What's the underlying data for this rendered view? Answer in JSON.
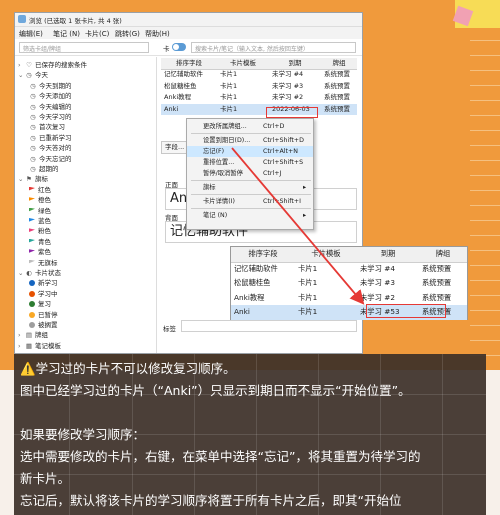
{
  "window": {
    "title": "浏览 (已选取 1 张卡片, 共 4 张)",
    "menus": [
      "编辑(E)",
      "笔记 (N)",
      "卡片(C)",
      "跳转(G)",
      "帮助(H)"
    ],
    "toggle_label": "卡",
    "sidebar_search_placeholder": "筛选卡组/牌组",
    "search_placeholder": "搜索卡片/笔记（输入文本, 然后按回车键）"
  },
  "sidebar": [
    {
      "label": "已保存的搜索条件",
      "icon": "heart-icon",
      "level": 0
    },
    {
      "label": "今天",
      "icon": "clock-icon",
      "level": 0,
      "expanded": true
    },
    {
      "label": "今天到期的",
      "icon": "clock-icon",
      "level": 1
    },
    {
      "label": "今天添加的",
      "icon": "clock-icon",
      "level": 1
    },
    {
      "label": "今天编辑的",
      "icon": "clock-icon",
      "level": 1
    },
    {
      "label": "今天学习的",
      "icon": "clock-icon",
      "level": 1
    },
    {
      "label": "首次复习",
      "icon": "clock-icon",
      "level": 1
    },
    {
      "label": "已重新学习",
      "icon": "clock-icon",
      "level": 1
    },
    {
      "label": "今天答对的",
      "icon": "clock-icon",
      "level": 1
    },
    {
      "label": "今天忘记的",
      "icon": "clock-icon",
      "level": 1
    },
    {
      "label": "超期的",
      "icon": "clock-icon",
      "level": 1
    },
    {
      "label": "旗标",
      "icon": "flag-icon",
      "level": 0,
      "expanded": true
    },
    {
      "label": "红色",
      "color": "#e53935",
      "kind": "flag",
      "level": 1
    },
    {
      "label": "橙色",
      "color": "#fb8c00",
      "kind": "flag",
      "level": 1
    },
    {
      "label": "绿色",
      "color": "#43a047",
      "kind": "flag",
      "level": 1
    },
    {
      "label": "蓝色",
      "color": "#1e88e5",
      "kind": "flag",
      "level": 1
    },
    {
      "label": "粉色",
      "color": "#ec407a",
      "kind": "flag",
      "level": 1
    },
    {
      "label": "青色",
      "color": "#26a69a",
      "kind": "flag",
      "level": 1
    },
    {
      "label": "紫色",
      "color": "#8e24aa",
      "kind": "flag",
      "level": 1
    },
    {
      "label": "无旗标",
      "color": "#bdbdbd",
      "kind": "flag",
      "level": 1
    },
    {
      "label": "卡片状态",
      "icon": "state-icon",
      "level": 0,
      "expanded": true
    },
    {
      "label": "新学习",
      "color": "#1565c0",
      "kind": "dot",
      "level": 1
    },
    {
      "label": "学习中",
      "color": "#e65100",
      "kind": "dot",
      "level": 1
    },
    {
      "label": "复习",
      "color": "#2e7d32",
      "kind": "dot",
      "level": 1
    },
    {
      "label": "已暂停",
      "color": "#f9a825",
      "kind": "dot",
      "level": 1
    },
    {
      "label": "被搁置",
      "color": "#9e9e9e",
      "kind": "dot",
      "level": 1
    },
    {
      "label": "牌组",
      "icon": "deck-icon",
      "level": 0
    },
    {
      "label": "笔记模板",
      "icon": "note-type-icon",
      "level": 0
    }
  ],
  "table": {
    "columns": [
      "排序字段",
      "卡片模板",
      "到期",
      "牌组"
    ],
    "rows": [
      [
        "记忆辅助软件",
        "卡片1",
        "未学习 #4",
        "系统预置"
      ],
      [
        "松鼠糖桂鱼",
        "卡片1",
        "未学习 #3",
        "系统预置"
      ],
      [
        "Anki教程",
        "卡片1",
        "未学习 #2",
        "系统预置"
      ],
      [
        "Anki",
        "卡片1",
        "2022-06-03",
        "系统预置"
      ]
    ]
  },
  "editor": {
    "fields_button": "字段...",
    "front_label": "正面",
    "front_value": "Anki",
    "back_label": "背面",
    "back_value": "记忆辅助软件",
    "tags_label": "标签"
  },
  "context_menu": [
    {
      "label": "更改所属牌组...",
      "shortcut": "Ctrl+D"
    },
    {
      "sep": true
    },
    {
      "label": "设置到期日(D)...",
      "shortcut": "Ctrl+Shift+D"
    },
    {
      "label": "忘记(F)",
      "shortcut": "Ctrl+Alt+N",
      "highlight": true
    },
    {
      "label": "重排位置...",
      "shortcut": "Ctrl+Shift+S"
    },
    {
      "label": "暂停/取消暂停",
      "shortcut": "Ctrl+J"
    },
    {
      "sep": true
    },
    {
      "label": "旗标",
      "shortcut": "",
      "submenu": true
    },
    {
      "sep": true
    },
    {
      "label": "卡片详情(I)",
      "shortcut": "Ctrl+Shift+I"
    },
    {
      "sep": true
    },
    {
      "label": "笔记 (N)",
      "shortcut": "",
      "submenu": true
    }
  ],
  "zoom_table": {
    "columns": [
      "排序字段",
      "卡片模板",
      "到期",
      "牌组"
    ],
    "rows": [
      [
        "记忆辅助软件",
        "卡片1",
        "未学习 #4",
        "系统预置"
      ],
      [
        "松鼠糖桂鱼",
        "卡片1",
        "未学习 #3",
        "系统预置"
      ],
      [
        "Anki教程",
        "卡片1",
        "未学习 #2",
        "系统预置"
      ],
      [
        "Anki",
        "卡片1",
        "未学习 #53",
        "系统预置"
      ]
    ]
  },
  "caption": {
    "lines": [
      "⚠️学习过的卡片不可以修改复习顺序。",
      "图中已经学习过的卡片（“Anki”）只显示到期日而不显示“开始位置”。",
      "",
      "如果要修改学习顺序：",
      "选中需要修改的卡片，右键，在菜单中选择“忘记”，将其重置为待学习的",
      "新卡片。",
      "忘记后，默认将该卡片的学习顺序将置于所有卡片之后，即其“开始位"
    ]
  },
  "colors": {
    "accent": "#e53935",
    "selection": "#cfe3f7",
    "highlight": "#cde8ff"
  }
}
